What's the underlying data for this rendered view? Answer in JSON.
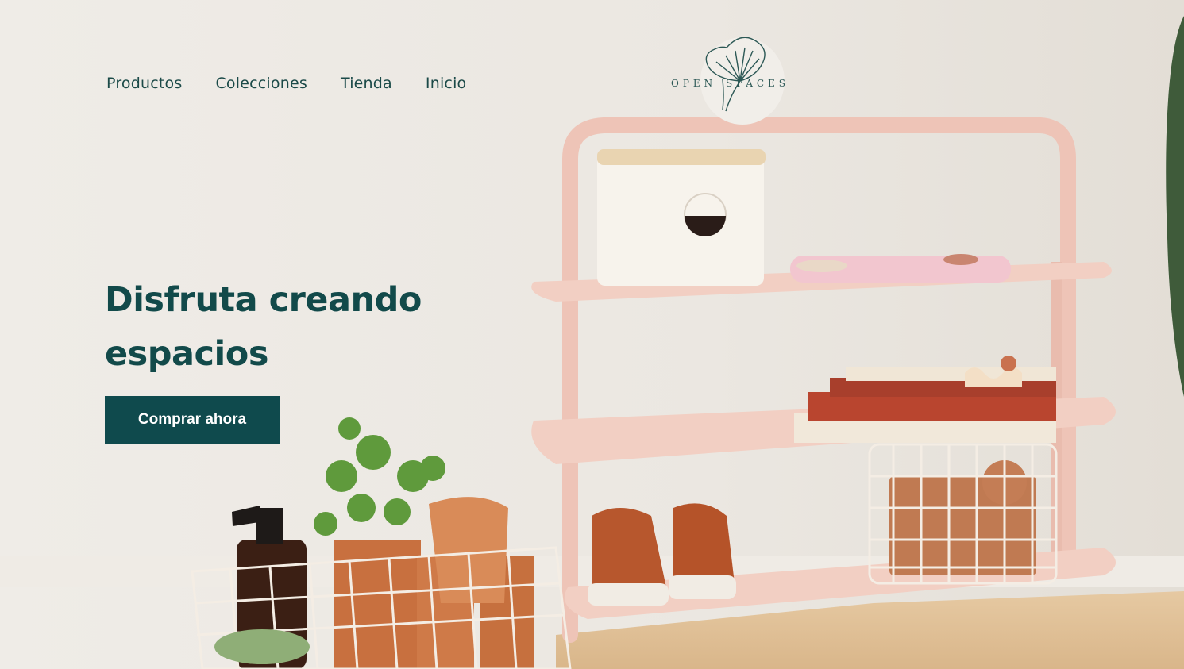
{
  "nav": {
    "items": [
      {
        "label": "Productos"
      },
      {
        "label": "Colecciones"
      },
      {
        "label": "Tienda"
      },
      {
        "label": "Inicio"
      }
    ]
  },
  "logo": {
    "word_left": "OPEN",
    "word_right": "SPACES"
  },
  "hero": {
    "headline": "Disfruta creando espacios",
    "cta_label": "Comprar ahora"
  },
  "colors": {
    "brand": "#0f4a4d",
    "nav_text": "#1b4a48",
    "shelf": "#f0c9bd",
    "background": "#ece8e2"
  }
}
